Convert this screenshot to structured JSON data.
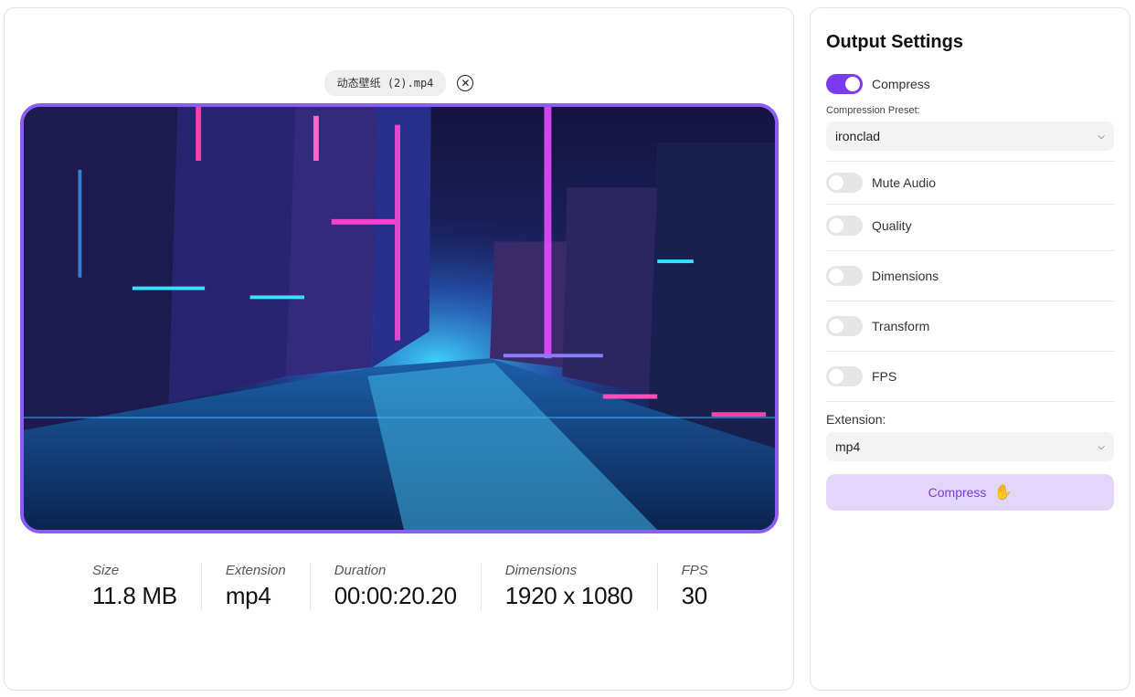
{
  "file": {
    "name": "动态壁纸 (2).mp4",
    "close_icon": "close-circle-icon"
  },
  "stats": [
    {
      "label": "Size",
      "value": "11.8 MB"
    },
    {
      "label": "Extension",
      "value": "mp4"
    },
    {
      "label": "Duration",
      "value": "00:00:20.20"
    },
    {
      "label": "Dimensions",
      "value": "1920 x 1080"
    },
    {
      "label": "FPS",
      "value": "30"
    }
  ],
  "settings": {
    "title": "Output Settings",
    "compress_toggle": {
      "label": "Compress",
      "on": true
    },
    "preset_label": "Compression Preset:",
    "preset_value": "ironclad",
    "toggles": [
      {
        "label": "Mute Audio",
        "on": false
      },
      {
        "label": "Quality",
        "on": false
      },
      {
        "label": "Dimensions",
        "on": false
      },
      {
        "label": "Transform",
        "on": false
      },
      {
        "label": "FPS",
        "on": false
      }
    ],
    "extension_label": "Extension:",
    "extension_value": "mp4",
    "compress_button": "Compress",
    "accent_color": "#7c3aed"
  }
}
